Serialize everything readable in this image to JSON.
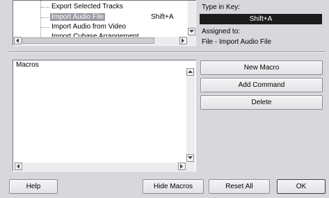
{
  "commands_tree": {
    "items": [
      {
        "label": "Export Selected Tracks",
        "shortcut": ""
      },
      {
        "label": "Import Audio File",
        "shortcut": "Shift+A"
      },
      {
        "label": "Import Audio from Video",
        "shortcut": ""
      },
      {
        "label": "Import Cubase Arrangement",
        "shortcut": ""
      }
    ],
    "selected_index": 1
  },
  "key_panel": {
    "type_in_key_label": "Type in Key:",
    "type_in_key_value": "Shift+A",
    "assigned_to_label": "Assigned to:",
    "assigned_to_value": "File - Import Audio File"
  },
  "macros": {
    "header": "Macros",
    "new_macro_label": "New Macro",
    "add_command_label": "Add Command",
    "delete_label": "Delete"
  },
  "footer": {
    "help_label": "Help",
    "hide_macros_label": "Hide Macros",
    "reset_all_label": "Reset All",
    "ok_label": "OK"
  },
  "colors": {
    "window_bg": "#d8d8dc",
    "key_field_bg": "#1c1c1c",
    "selected_item_fg": "#ffffff"
  }
}
